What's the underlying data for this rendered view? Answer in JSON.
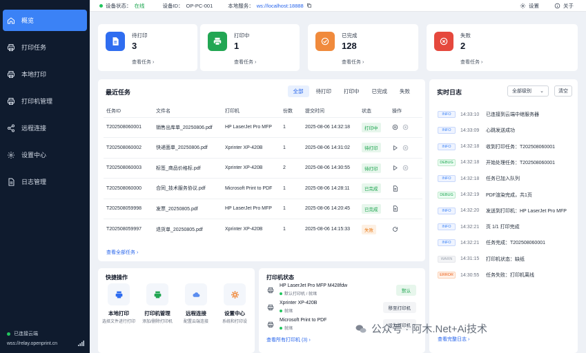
{
  "sidebar": {
    "items": [
      {
        "label": "概览",
        "icon": "home-icon"
      },
      {
        "label": "打印任务",
        "icon": "printer-icon"
      },
      {
        "label": "本地打印",
        "icon": "printer-icon"
      },
      {
        "label": "打印机管理",
        "icon": "printer-icon"
      },
      {
        "label": "远程连接",
        "icon": "share-icon"
      },
      {
        "label": "设置中心",
        "icon": "gear-icon"
      },
      {
        "label": "日志管理",
        "icon": "document-icon"
      }
    ],
    "connection": {
      "status": "已连接云端",
      "url": "wss://relay.openprint.cn"
    }
  },
  "topbar": {
    "device_status_label": "设备状态：",
    "device_status_value": "在线",
    "device_id_label": "设备ID：",
    "device_id_value": "OP-PC-001",
    "local_service_label": "本地服务：",
    "local_service_value": "ws://localhost:18888",
    "settings_label": "设置",
    "about_label": "关于"
  },
  "stats": [
    {
      "label": "待打印",
      "value": "3",
      "more": "查看任务",
      "color": "#2f6df0",
      "icon": "document-icon"
    },
    {
      "label": "打印中",
      "value": "1",
      "more": "查看任务",
      "color": "#22a653",
      "icon": "printer-icon"
    },
    {
      "label": "已完成",
      "value": "128",
      "more": "查看任务",
      "color": "#f08a3c",
      "icon": "check-circle-icon"
    },
    {
      "label": "失败",
      "value": "2",
      "more": "查看任务",
      "color": "#e5483d",
      "icon": "close-circle-icon"
    }
  ],
  "tasks": {
    "title": "最近任务",
    "tabs": [
      "全部",
      "待打印",
      "打印中",
      "已完成",
      "失败"
    ],
    "columns": [
      "任务ID",
      "文件名",
      "打印机",
      "份数",
      "提交时间",
      "状态",
      "操作"
    ],
    "rows": [
      {
        "id": "T202508060001",
        "file": "销售出库单_20250806.pdf",
        "printer": "HP LaserJet Pro MFP",
        "copies": "1",
        "time": "2025-08-06 14:32:18",
        "status": "打印中",
        "cls": "b-printing",
        "actions": [
          "pause-icon",
          "cancel-icon"
        ]
      },
      {
        "id": "T202508060002",
        "file": "快递面单_20250806.pdf",
        "printer": "Xprinter XP-420B",
        "copies": "1",
        "time": "2025-08-06 14:31:02",
        "status": "待打印",
        "cls": "b-waiting",
        "actions": [
          "play-icon",
          "cancel-icon"
        ]
      },
      {
        "id": "T202508060003",
        "file": "标签_商品价格标.pdf",
        "printer": "Xprinter XP-420B",
        "copies": "2",
        "time": "2025-08-06 14:30:55",
        "status": "待打印",
        "cls": "b-waiting",
        "actions": [
          "play-icon",
          "cancel-icon"
        ]
      },
      {
        "id": "T202508060000",
        "file": "合同_技术服务协议.pdf",
        "printer": "Microsoft Print to PDF",
        "copies": "1",
        "time": "2025-08-06 14:28:11",
        "status": "已完成",
        "cls": "b-done",
        "actions": [
          "doc-icon"
        ]
      },
      {
        "id": "T202508059998",
        "file": "发票_20250805.pdf",
        "printer": "HP LaserJet Pro MFP",
        "copies": "1",
        "time": "2025-08-06 14:20:45",
        "status": "已完成",
        "cls": "b-done",
        "actions": [
          "doc-icon"
        ]
      },
      {
        "id": "T202508059997",
        "file": "退货单_20250805.pdf",
        "printer": "Xprinter XP-420B",
        "copies": "1",
        "time": "2025-08-06 14:15:33",
        "status": "失败",
        "cls": "b-fail",
        "actions": [
          "retry-icon"
        ]
      }
    ],
    "view_all": "查看全部任务"
  },
  "logs": {
    "title": "实时日志",
    "level_select": "全部级别",
    "clear": "清空",
    "entries": [
      {
        "level": "INFO",
        "time": "14:33:10",
        "msg": "已连接到云端中继服务器"
      },
      {
        "level": "INFO",
        "time": "14:33:09",
        "msg": "心跳发送成功"
      },
      {
        "level": "INFO",
        "time": "14:32:18",
        "msg": "收到打印任务：T202508060001"
      },
      {
        "level": "DEBUG",
        "time": "14:32:18",
        "msg": "开始处理任务：T202508060001"
      },
      {
        "level": "INFO",
        "time": "14:32:18",
        "msg": "任务已加入队列"
      },
      {
        "level": "DEBUG",
        "time": "14:32:19",
        "msg": "PDF渲染完成，共1页"
      },
      {
        "level": "INFO",
        "time": "14:32:20",
        "msg": "发送到打印机：HP LaserJet Pro MFP"
      },
      {
        "level": "INFO",
        "time": "14:32:21",
        "msg": "页 1/1 打印完成"
      },
      {
        "level": "INFO",
        "time": "14:32:21",
        "msg": "任务完成：T202508060001"
      },
      {
        "level": "WARN",
        "time": "14:31:15",
        "msg": "打印机状态：缺纸"
      },
      {
        "level": "ERROR",
        "time": "14:30:55",
        "msg": "任务失败：打印机离线"
      }
    ],
    "view_all": "查看完整日志"
  },
  "quick": {
    "title": "快捷操作",
    "items": [
      {
        "title": "本地打印",
        "desc": "选择文件进行打印",
        "color": "#2f6df0"
      },
      {
        "title": "打印机管理",
        "desc": "添加/删除打印机",
        "color": "#22a653"
      },
      {
        "title": "远程连接",
        "desc": "配置云端连接",
        "color": "#5b8def"
      },
      {
        "title": "设置中心",
        "desc": "系统和打印设",
        "color": "#f08a3c"
      }
    ]
  },
  "printers": {
    "title": "打印机状态",
    "items": [
      {
        "name": "HP LaserJet Pro MFP M428fdw",
        "status": "默认打印机 / 就绪",
        "btn": "默认"
      },
      {
        "name": "Xprinter XP-420B",
        "status": "就绪",
        "btn": "移至打印机"
      },
      {
        "name": "Microsoft Print to PDF",
        "status": "就绪",
        "btn": "设为打印机"
      }
    ],
    "view_all": "查看所有打印机 (3)"
  },
  "watermark": "公众号 · 阿木.Net+Ai技术"
}
